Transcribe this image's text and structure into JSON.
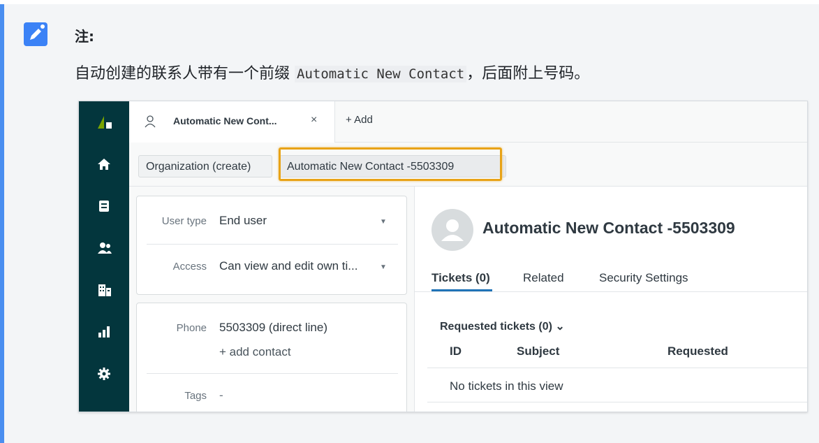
{
  "note": {
    "label": "注:",
    "text_before": "自动创建的联系人带有一个前缀 ",
    "code": "Automatic New Contact",
    "text_after": "，后面附上号码。"
  },
  "sidebar": {
    "items": [
      {
        "icon": "logo-icon"
      },
      {
        "icon": "home-icon"
      },
      {
        "icon": "views-icon"
      },
      {
        "icon": "customers-icon"
      },
      {
        "icon": "organizations-icon"
      },
      {
        "icon": "reporting-icon"
      },
      {
        "icon": "admin-gear-icon"
      }
    ]
  },
  "tabs": {
    "active_title": "Automatic New Cont...",
    "close": "×",
    "add": "+ Add"
  },
  "breadcrumb": {
    "org": "Organization (create)",
    "contact": "Automatic New Contact -5503309"
  },
  "user_card": {
    "user_type_label": "User type",
    "user_type_value": "End user",
    "access_label": "Access",
    "access_value": "Can view and edit own ti..."
  },
  "contact_card": {
    "phone_label": "Phone",
    "phone_value": "5503309 (direct line)",
    "add_contact": "+ add contact",
    "tags_label": "Tags",
    "tags_value": "-"
  },
  "profile": {
    "name": "Automatic New Contact -5503309",
    "tabs": [
      "Tickets (0)",
      "Related",
      "Security Settings"
    ],
    "requested_title": "Requested tickets (0) ⌄",
    "columns": [
      "ID",
      "Subject",
      "Requested"
    ],
    "empty": "No tickets in this view"
  },
  "colors": {
    "note_accent": "#4a8ef0",
    "rail": "#03363d",
    "highlight": "#e8a317",
    "tab_underline": "#1f73b7"
  }
}
